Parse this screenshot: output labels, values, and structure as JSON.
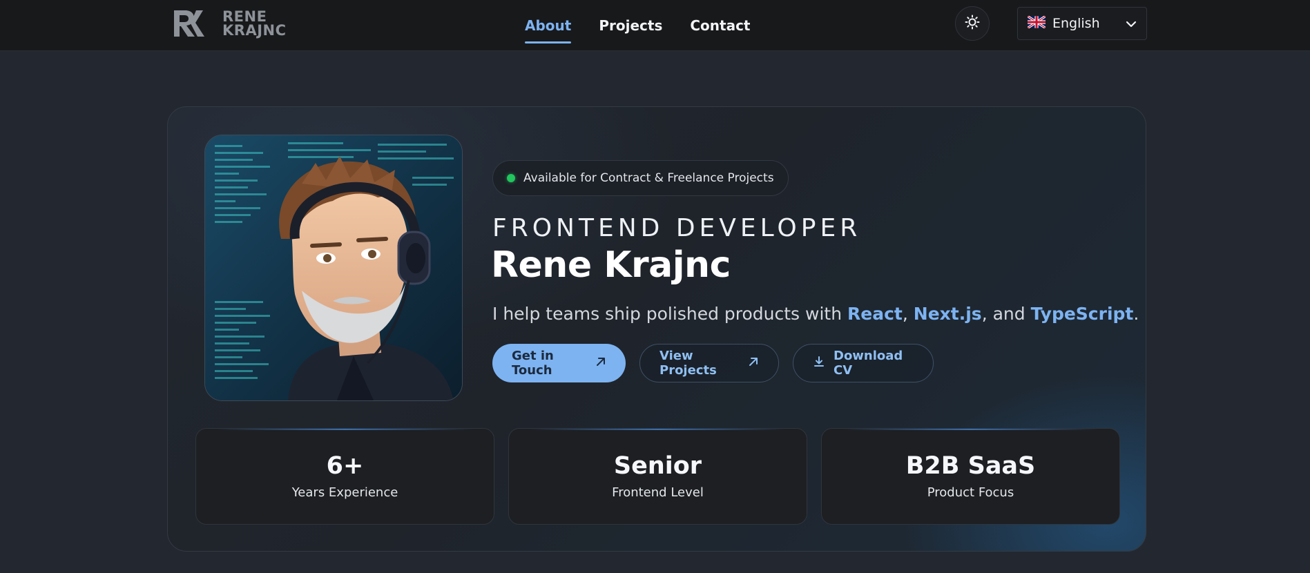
{
  "header": {
    "logo_line1": "RENE",
    "logo_line2": "KRAJNC",
    "nav": [
      {
        "label": "About",
        "active": true
      },
      {
        "label": "Projects",
        "active": false
      },
      {
        "label": "Contact",
        "active": false
      }
    ],
    "theme_toggle_icon": "sun-icon",
    "language": {
      "selected": "English",
      "flag_icon": "uk-flag-icon"
    }
  },
  "hero": {
    "availability": "Available for Contract & Freelance Projects",
    "role": "FRONTEND DEVELOPER",
    "name": "Rene Krajnc",
    "tagline": {
      "prefix": "I help teams ship polished products with ",
      "tech1": "React",
      "sep1": ", ",
      "tech2": "Next.js",
      "sep2": ", and ",
      "tech3": "TypeScript",
      "suffix": "."
    },
    "buttons": {
      "contact": "Get in Touch",
      "projects": "View Projects",
      "cv": "Download CV"
    }
  },
  "stats": [
    {
      "value": "6+",
      "label": "Years Experience"
    },
    {
      "value": "Senior",
      "label": "Frontend Level"
    },
    {
      "value": "B2B SaaS",
      "label": "Product Focus"
    }
  ],
  "colors": {
    "accent": "#7db3f1",
    "status_green": "#22c55e",
    "background": "#232830",
    "topbar": "#18191b"
  }
}
